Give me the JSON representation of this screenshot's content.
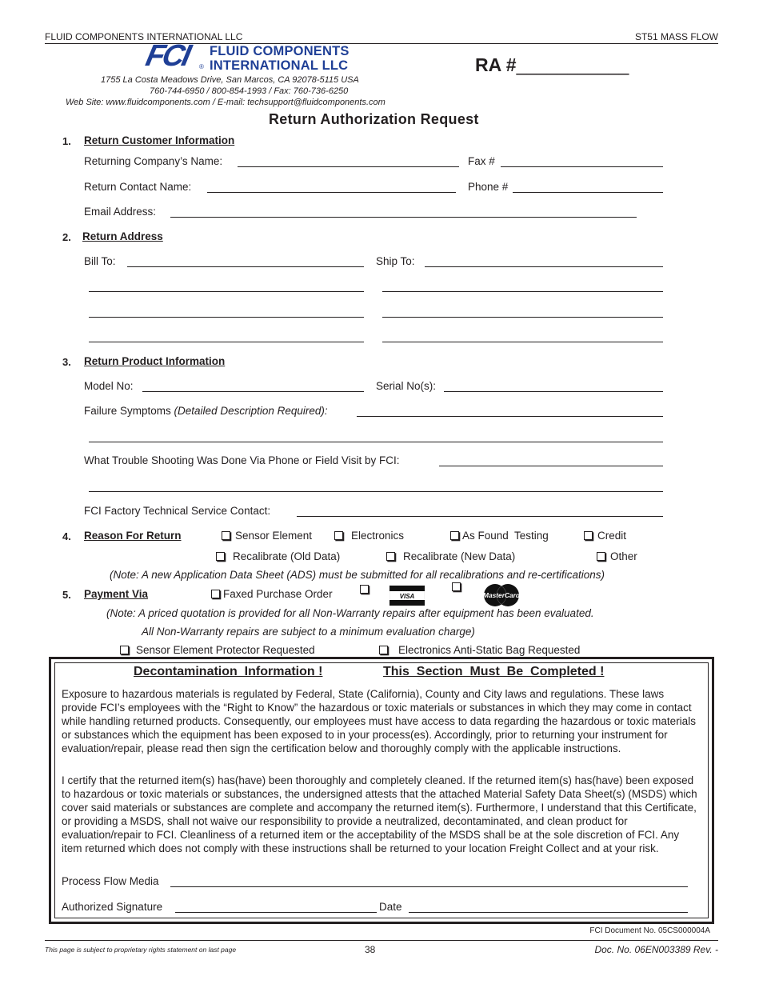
{
  "header": {
    "company": "FLUID COMPONENTS INTERNATIONAL LLC",
    "product": "ST51 MASS FLOW"
  },
  "logo": {
    "mark": "FCI",
    "line1": "FLUID COMPONENTS",
    "line2": "INTERNATIONAL LLC",
    "registered": "®",
    "color": "#1f3f96"
  },
  "contact": {
    "address": "1755 La Costa Meadows Drive, San Marcos, CA 92078-5115 USA",
    "phones": "760-744-6950  /  800-854-1993  /  Fax: 760-736-6250",
    "web": "Web Site: www.fluidcomponents.com  /  E-mail: techsupport@fluidcomponents.com"
  },
  "ra": {
    "label": "RA #",
    "blank": "___________"
  },
  "form_title": "Return  Authorization  Request",
  "sections": {
    "customer": {
      "num": "1.",
      "title": "Return Customer Information",
      "company_label": "Returning Company’s Name:",
      "fax_label": "Fax #",
      "contact_label": "Return Contact Name:",
      "phone_label": "Phone #",
      "email_label": "Email Address:"
    },
    "address": {
      "num": "2.",
      "title": "Return Address",
      "bill_label": "Bill To:",
      "ship_label": "Ship To:"
    },
    "product": {
      "num": "3.",
      "title": "Return Product Information",
      "model_label": "Model No:",
      "serial_label": "Serial No(s):",
      "failure_label": "Failure Symptoms",
      "failure_hint": "(Detailed Description Required):",
      "troubleshoot_label": "What Trouble Shooting Was Done Via Phone or Field Visit by FCI:",
      "contact_label": "FCI Factory Technical Service Contact:"
    },
    "reason": {
      "num": "4.",
      "title": "Reason For Return",
      "options": [
        "Sensor Element",
        "Electronics",
        "As Found  Testing",
        "Credit",
        "Recalibrate (Old Data)",
        "Recalibrate (New Data)",
        "Other"
      ],
      "note": "(Note: A new Application Data Sheet (ADS) must be submitted for all recalibrations and re-certifications)"
    },
    "payment": {
      "num": "5.",
      "title": "Payment Via",
      "options": [
        "Faxed Purchase Order",
        "VISA",
        "MasterCard"
      ],
      "note1": "(Note: A priced quotation is provided for all Non-Warranty repairs after equipment has been evaluated.",
      "note2": "All Non-Warranty repairs are subject to a minimum evaluation charge)",
      "extras": [
        "Sensor Element Protector Requested",
        "Electronics Anti-Static Bag Requested"
      ]
    }
  },
  "decon": {
    "heading1": "Decontamination  Information !",
    "heading2": "This  Section  Must  Be  Completed !",
    "para1": "Exposure to hazardous materials is regulated by Federal, State (California), County and City laws and regulations. These laws provide FCI’s employees with the “Right to Know” the hazardous or toxic materials or substances in which they may come in contact while handling returned products.  Consequently, our employees must have access to data regarding the hazardous or toxic materials or substances which the equipment has been exposed to in your process(es). Accordingly, prior to returning your instrument for evaluation/repair, please read then sign the certification below and thoroughly comply with the applicable instructions.",
    "para2": "I certify that the returned item(s) has(have) been thoroughly and completely cleaned. If the returned item(s) has(have) been exposed to hazardous or toxic materials or substances, the undersigned attests that the attached Material Safety Data Sheet(s) (MSDS) which cover said materials or substances are complete and accompany the returned item(s). Furthermore, I understand that this Certificate, or providing a MSDS, shall not waive our responsibility to provide a neutralized, decontaminated, and clean product for evaluation/repair to FCI. Cleanliness of a returned item or the acceptability of the MSDS shall be at the sole discretion of FCI. Any item returned which does not comply with these instructions shall be returned to your location Freight Collect and at your risk.",
    "media_label": "Process Flow Media",
    "signature_label": "Authorized Signature",
    "date_label": "Date"
  },
  "footer": {
    "form_doc": "FCI Document No. 05CS000004A",
    "proprietary": "This page is subject to proprietary rights statement on last page",
    "page": "38",
    "doc_no": "Doc. No. 06EN003389 Rev. -"
  }
}
